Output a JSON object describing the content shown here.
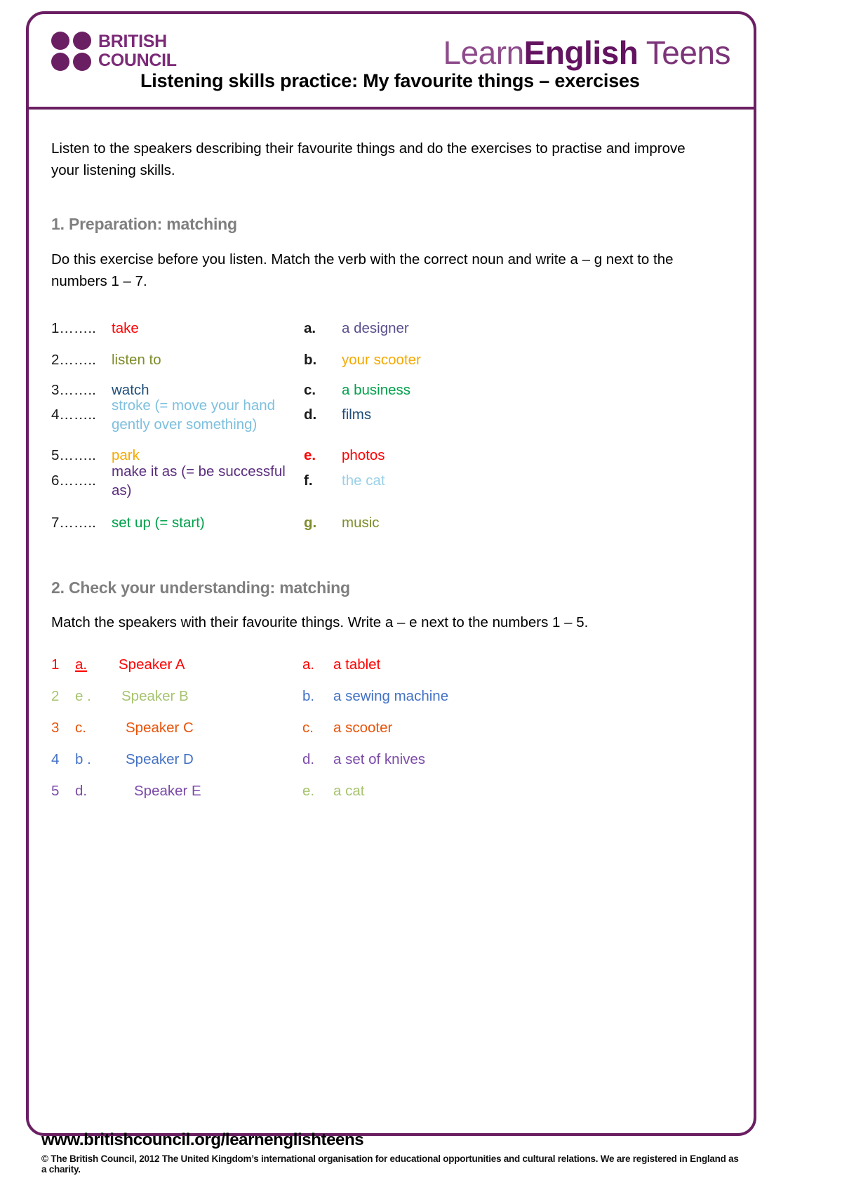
{
  "branding": {
    "british_council": {
      "line1": "BRITISH",
      "line2": "COUNCIL",
      "color": "#6B1F63"
    },
    "learnenglish": {
      "learn": "Learn",
      "english": "English",
      "teens": " Teens",
      "color": "#7C3479"
    }
  },
  "document": {
    "title": "Listening skills practice: My favourite things – exercises",
    "intro": "Listen to the speakers describing their favourite things and do the exercises to practise and improve your listening skills."
  },
  "exercise1": {
    "heading": "1. Preparation: matching",
    "instruction": "Do this exercise before you listen. Match the verb with the correct noun and write a – g next to the numbers 1 – 7.",
    "left": [
      {
        "num": "1……..",
        "verb": "take",
        "color": "#FF0000"
      },
      {
        "num": "2……..",
        "verb": "listen to",
        "color": "#7E8C2A"
      },
      {
        "num": "3……..",
        "verb": "watch",
        "color": "#1F4E79"
      },
      {
        "num": "4……..",
        "verb": "stroke (= move your hand gently over something)",
        "color": "#7EC0DE"
      },
      {
        "num": "5……..",
        "verb": "park",
        "color": "#F5A800"
      },
      {
        "num": "6……..",
        "verb": "make it as (= be successful as)",
        "color": "#5B2D7E"
      },
      {
        "num": "7……..",
        "verb": "set up (= start)",
        "color": "#00A14B"
      }
    ],
    "right": [
      {
        "letter": "a.",
        "letter_color": "#1a1a1a",
        "noun": "a designer",
        "color": "#5B4E8C"
      },
      {
        "letter": "b.",
        "letter_color": "#1a1a1a",
        "noun": "your scooter",
        "color": "#F5A800"
      },
      {
        "letter": "c.",
        "letter_color": "#1a1a1a",
        "noun": "a business",
        "color": "#00A14B"
      },
      {
        "letter": "d.",
        "letter_color": "#1a1a1a",
        "noun": "films",
        "color": "#1F4E79"
      },
      {
        "letter": "e.",
        "letter_color": "#FF0000",
        "noun": "photos",
        "color": "#FF0000"
      },
      {
        "letter": "f.",
        "letter_color": "#1a1a1a",
        "noun": "the cat",
        "color": "#9AD0E8"
      },
      {
        "letter": "g.",
        "letter_color": "#7E8C2A",
        "noun": "music",
        "color": "#7E8C2A"
      }
    ]
  },
  "exercise2": {
    "heading": "2. Check your understanding: matching",
    "instruction": "Match the speakers with their favourite things. Write a – e next to the numbers 1 – 5.",
    "speakers": [
      {
        "num": "1",
        "answer": "a.",
        "label": "Speaker A",
        "color": "#FF0000",
        "underline": true
      },
      {
        "num": "2",
        "answer": "e .",
        "label": "Speaker B",
        "color": "#A7C470",
        "underline": false
      },
      {
        "num": "3",
        "answer": "c.",
        "label": "Speaker C",
        "color": "#E8540A",
        "underline": false
      },
      {
        "num": "4",
        "answer": "b .",
        "label": "Speaker D",
        "color": "#4472C4",
        "underline": false
      },
      {
        "num": "5",
        "answer": "d.",
        "label": "Speaker E",
        "color": "#7C4BA8",
        "underline": false
      }
    ],
    "things": [
      {
        "letter": "a.",
        "text": "a tablet",
        "color": "#FF0000"
      },
      {
        "letter": "b.",
        "text": "a sewing machine",
        "color": "#4472C4"
      },
      {
        "letter": "c.",
        "text": "a scooter",
        "color": "#E8540A"
      },
      {
        "letter": "d.",
        "text": "a set of knives",
        "color": "#7C4BA8"
      },
      {
        "letter": "e.",
        "text": "a cat",
        "color": "#A7C470"
      }
    ]
  },
  "footer": {
    "url": "www.britishcouncil.org/learnenglishteens",
    "legal": "© The British Council, 2012 The United Kingdom’s international organisation for educational opportunities and cultural relations. We are registered in England as a charity."
  }
}
